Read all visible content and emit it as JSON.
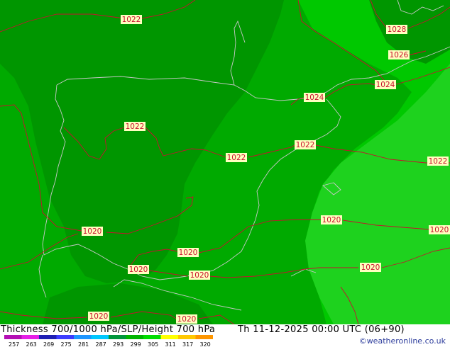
{
  "map": {
    "title": "Thickness 700/1000 hPa/SLP/Height 700 hPa",
    "valid_time": "Th 11-12-2025 00:00 UTC (06+90)",
    "credit": "©weatheronline.co.uk",
    "colors": {
      "dark_green": "#009600",
      "mid_green": "#00aa00",
      "light_green": "#00c800",
      "lighter_green": "#1ed21e",
      "isobar": "#c8102e",
      "coast": "#c8c8c8",
      "label_bg": "#ffffc0"
    },
    "isobar_labels": [
      "1022",
      "1028",
      "1026",
      "1024",
      "1024",
      "1022",
      "1022",
      "1022",
      "1022",
      "1020",
      "1020",
      "1020",
      "1020",
      "1020",
      "1020",
      "1020",
      "1020",
      "1020"
    ],
    "legend": {
      "ticks": [
        "257",
        "263",
        "269",
        "275",
        "281",
        "287",
        "293",
        "299",
        "305",
        "311",
        "317",
        "320"
      ],
      "colors": [
        "#b40fb4",
        "#e61ee6",
        "#1e1eb4",
        "#3c3cff",
        "#1e96ff",
        "#00c8ff",
        "#00963c",
        "#00b400",
        "#00dc00",
        "#ffff00",
        "#ffc800",
        "#ff9600"
      ]
    }
  }
}
